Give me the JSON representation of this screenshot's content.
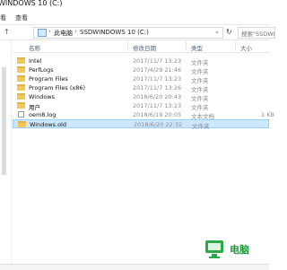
{
  "window": {
    "title": "WINDOWS 10 (C:)"
  },
  "menu": {
    "items": [
      "看",
      "查看"
    ]
  },
  "address": {
    "crumbs": [
      "此电脑",
      "SSDWINDOWS 10 (C:)"
    ],
    "search_placeholder": "搜索\"SSDWIN"
  },
  "columns": {
    "name": "名称",
    "date": "修改日期",
    "type": "类型",
    "size": "大小"
  },
  "files": [
    {
      "name": "Intel",
      "date": "2017/11/7 13:23",
      "type": "文件夹",
      "size": "",
      "icon": "folder-icon"
    },
    {
      "name": "PerfLogs",
      "date": "2017/4/29 21:46",
      "type": "文件夹",
      "size": "",
      "icon": "folder-icon"
    },
    {
      "name": "Program Files",
      "date": "2017/11/7 13:23",
      "type": "文件夹",
      "size": "",
      "icon": "folder-icon"
    },
    {
      "name": "Program Files (x86)",
      "date": "2017/11/7 13:26",
      "type": "文件夹",
      "size": "",
      "icon": "folder-icon"
    },
    {
      "name": "Windows",
      "date": "2018/6/20 20:43",
      "type": "文件夹",
      "size": "",
      "icon": "folder-icon"
    },
    {
      "name": "用户",
      "date": "2017/11/7 13:23",
      "type": "文件夹",
      "size": "",
      "icon": "folder-icon"
    },
    {
      "name": "oem8.log",
      "date": "2018/6/19 20:05",
      "type": "文本文档",
      "size": "1 KB",
      "icon": "text-file-icon"
    },
    {
      "name": "Windows.old",
      "date": "2018/6/20 22:32",
      "type": "文件夹",
      "size": "",
      "icon": "folder-icon",
      "selected": true
    }
  ],
  "watermark": {
    "text": "电脑",
    "sub": ""
  }
}
